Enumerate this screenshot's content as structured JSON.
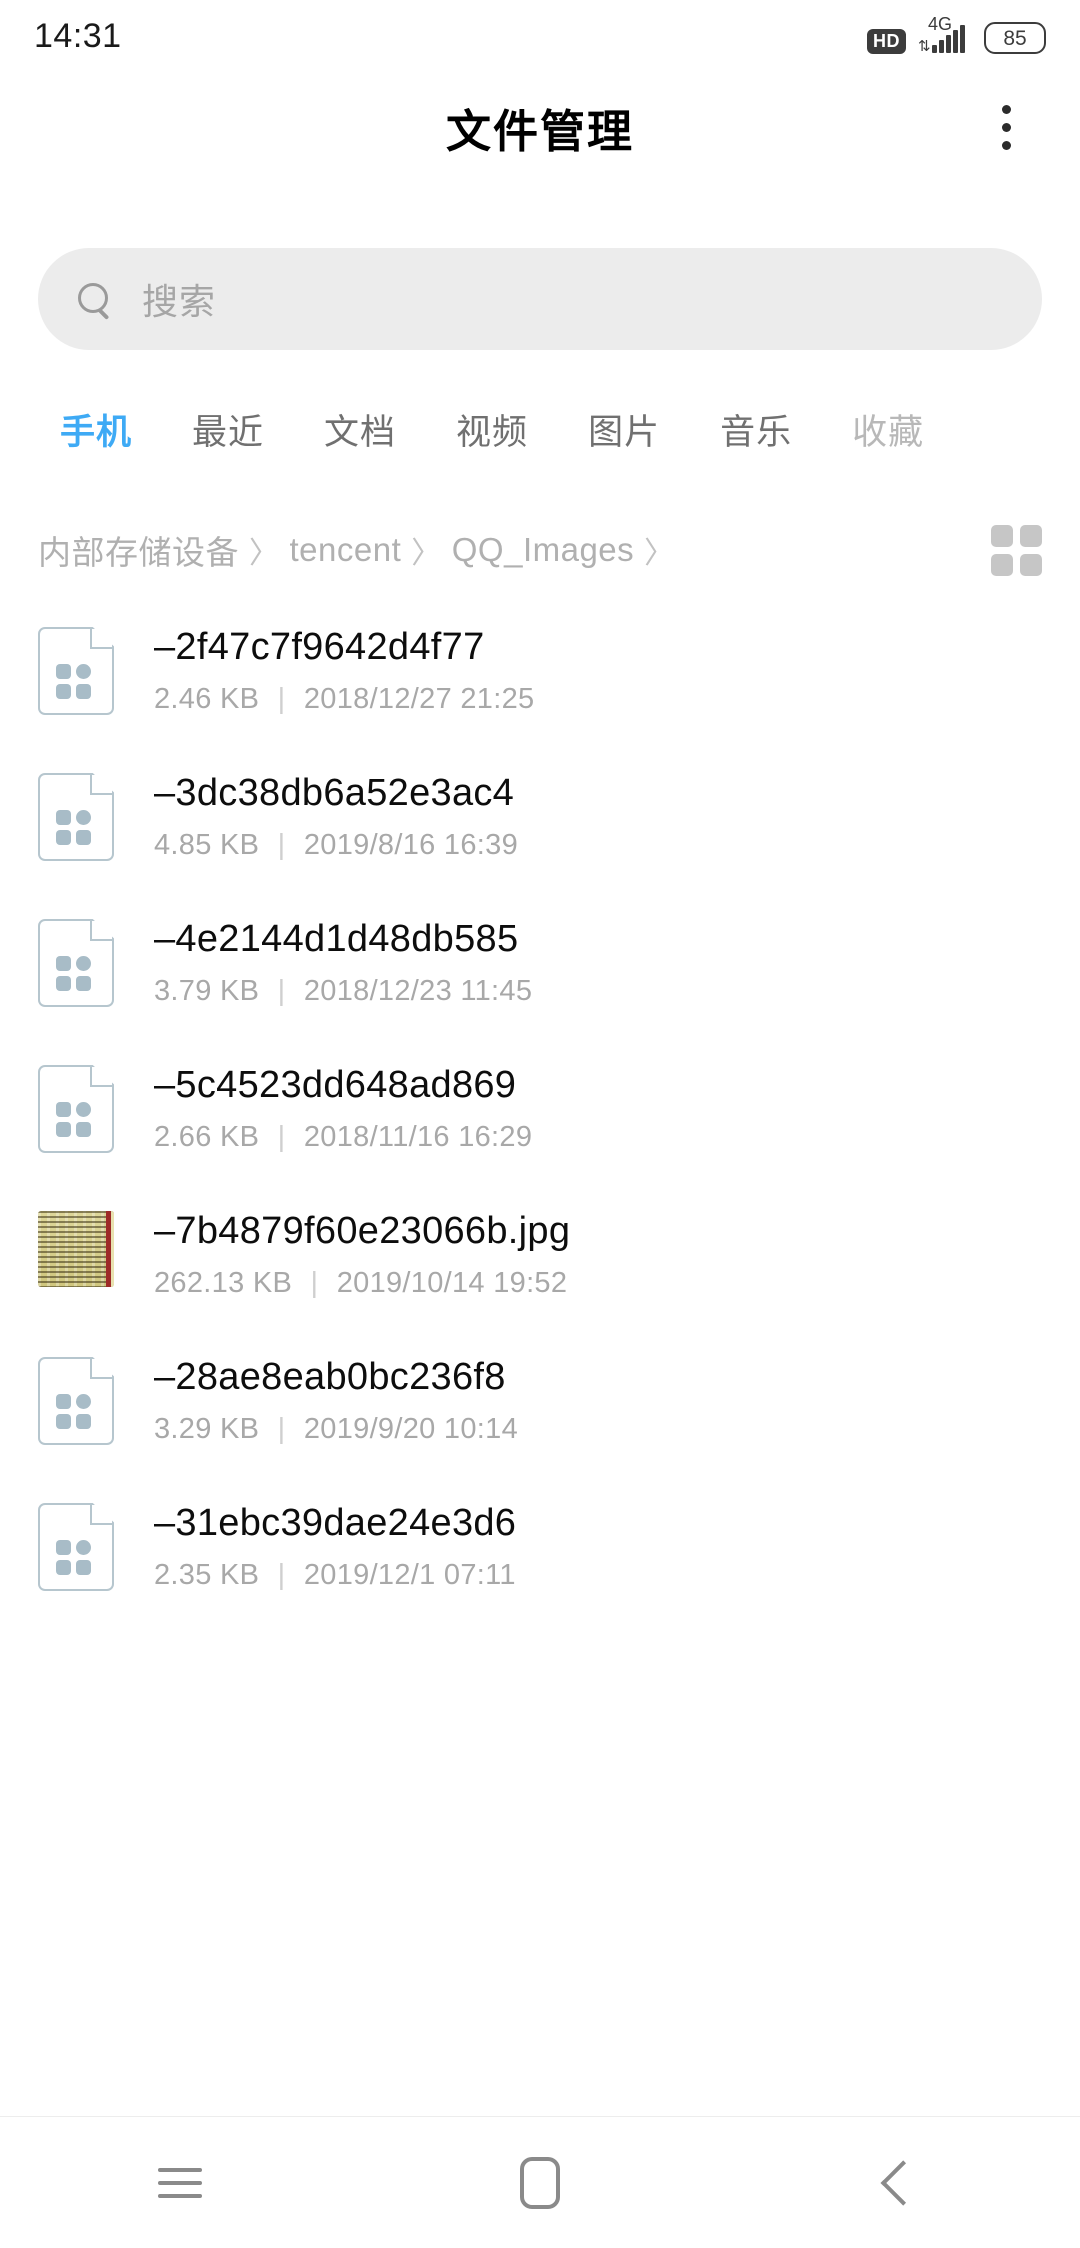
{
  "status_bar": {
    "time": "14:31",
    "hd_label": "HD",
    "network": "4G",
    "battery": "85"
  },
  "header": {
    "title": "文件管理",
    "overflow_label": "更多"
  },
  "search": {
    "placeholder": "搜索",
    "value": ""
  },
  "tabs": [
    {
      "label": "手机",
      "active": true
    },
    {
      "label": "最近",
      "active": false
    },
    {
      "label": "文档",
      "active": false
    },
    {
      "label": "视频",
      "active": false
    },
    {
      "label": "图片",
      "active": false
    },
    {
      "label": "音乐",
      "active": false
    },
    {
      "label": "收藏",
      "active": false
    }
  ],
  "breadcrumb": {
    "separator": "〉",
    "crumbs": [
      "内部存储设备",
      "tencent",
      "QQ_Images"
    ]
  },
  "view_toggle": {
    "mode": "grid-icon"
  },
  "files": [
    {
      "name": "–2f47c7f9642d4f77",
      "size": "2.46 KB",
      "modified": "2018/12/27 21:25",
      "icon": "file-icon"
    },
    {
      "name": "–3dc38db6a52e3ac4",
      "size": "4.85 KB",
      "modified": "2019/8/16 16:39",
      "icon": "file-icon"
    },
    {
      "name": "–4e2144d1d48db585",
      "size": "3.79 KB",
      "modified": "2018/12/23 11:45",
      "icon": "file-icon"
    },
    {
      "name": "–5c4523dd648ad869",
      "size": "2.66 KB",
      "modified": "2018/11/16 16:29",
      "icon": "file-icon"
    },
    {
      "name": "–7b4879f60e23066b.jpg",
      "size": "262.13 KB",
      "modified": "2019/10/14 19:52",
      "icon": "image-thumbnail"
    },
    {
      "name": "–28ae8eab0bc236f8",
      "size": "3.29 KB",
      "modified": "2019/9/20 10:14",
      "icon": "file-icon"
    },
    {
      "name": "–31ebc39dae24e3d6",
      "size": "2.35 KB",
      "modified": "2019/12/1 07:11",
      "icon": "file-icon"
    }
  ],
  "meta_separator": "|",
  "nav_bar": {
    "recents_label": "最近任务",
    "home_label": "主页",
    "back_label": "返回"
  },
  "colors": {
    "accent": "#3eaaf5",
    "text_primary": "#0d0d0d",
    "text_secondary": "#a8a8a8",
    "search_bg": "#ececec",
    "icon_blue_gray": "#b6c6ce"
  }
}
